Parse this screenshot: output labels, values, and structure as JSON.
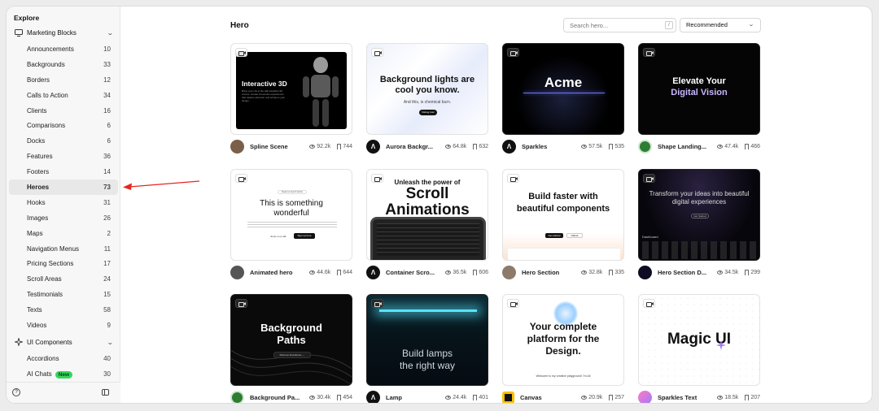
{
  "sidebar": {
    "heading": "Explore",
    "group1": {
      "label": "Marketing Blocks",
      "icon": "monitor-icon"
    },
    "items": [
      {
        "label": "Announcements",
        "count": "10"
      },
      {
        "label": "Backgrounds",
        "count": "33"
      },
      {
        "label": "Borders",
        "count": "12"
      },
      {
        "label": "Calls to Action",
        "count": "34"
      },
      {
        "label": "Clients",
        "count": "16"
      },
      {
        "label": "Comparisons",
        "count": "6"
      },
      {
        "label": "Docks",
        "count": "6"
      },
      {
        "label": "Features",
        "count": "36"
      },
      {
        "label": "Footers",
        "count": "14"
      },
      {
        "label": "Heroes",
        "count": "73"
      },
      {
        "label": "Hooks",
        "count": "31"
      },
      {
        "label": "Images",
        "count": "26"
      },
      {
        "label": "Maps",
        "count": "2"
      },
      {
        "label": "Navigation Menus",
        "count": "11"
      },
      {
        "label": "Pricing Sections",
        "count": "17"
      },
      {
        "label": "Scroll Areas",
        "count": "24"
      },
      {
        "label": "Testimonials",
        "count": "15"
      },
      {
        "label": "Texts",
        "count": "58"
      },
      {
        "label": "Videos",
        "count": "9"
      }
    ],
    "group2": {
      "label": "UI Components",
      "icon": "sparkle-icon"
    },
    "items2": [
      {
        "label": "Accordions",
        "count": "40"
      },
      {
        "label": "AI Chats",
        "count": "30",
        "badge": "New"
      }
    ],
    "help_glyph": "?"
  },
  "header": {
    "title": "Hero",
    "search_placeholder": "Search hero...",
    "search_shortcut": "/",
    "sort_value": "Recommended"
  },
  "cards": [
    {
      "name": "Spline Scene",
      "views": "92.2k",
      "saves": "744",
      "thumb": [
        "Interactive 3D",
        "Bring your UIs to life with beautiful 3D scenes. Create immersive experiences that capture attention and enhance your design."
      ]
    },
    {
      "name": "Aurora Backgr...",
      "views": "64.8k",
      "saves": "632",
      "thumb": [
        "Background lights are cool you know.",
        "And this, is chemical burn.",
        "Debug now"
      ]
    },
    {
      "name": "Sparkles",
      "views": "57.5k",
      "saves": "535",
      "thumb": [
        "Acme"
      ]
    },
    {
      "name": "Shape Landing...",
      "views": "47.4k",
      "saves": "466",
      "thumb": [
        "Elevate Your",
        "Digital Vision"
      ]
    },
    {
      "name": "Animated hero",
      "views": "44.6k",
      "saves": "644",
      "thumb": [
        "This is something",
        "wonderful",
        "Read our launch article",
        "Jump on a call",
        "Sign up here"
      ]
    },
    {
      "name": "Container Scro...",
      "views": "36.5k",
      "saves": "606",
      "thumb": [
        "Unleash the power of",
        "Scroll Animations"
      ]
    },
    {
      "name": "Hero Section",
      "views": "32.8k",
      "saves": "335",
      "thumb": [
        "Build faster with",
        "beautiful components",
        "Get started",
        "Github"
      ]
    },
    {
      "name": "Hero Section D...",
      "views": "34.5k",
      "saves": "299",
      "thumb": [
        "Transform your ideas into beautiful",
        "digital experiences",
        "Get Started",
        "Dashboard"
      ]
    },
    {
      "name": "Background Pa...",
      "views": "30.4k",
      "saves": "454",
      "thumb": [
        "Background",
        "Paths",
        "Discover Excellence →"
      ]
    },
    {
      "name": "Lamp",
      "views": "24.4k",
      "saves": "401",
      "thumb": [
        "Build lamps",
        "the right way"
      ]
    },
    {
      "name": "Canvas",
      "views": "20.9k",
      "saves": "257",
      "thumb": [
        "Your complete",
        "platform for the",
        "Design.",
        "Welcome to my creative playground! I'm Ali"
      ]
    },
    {
      "name": "Sparkles Text",
      "views": "18.5k",
      "saves": "207",
      "thumb": [
        "Magic UI"
      ]
    }
  ],
  "colors": {
    "arrow": "#e8251f",
    "badge_new": "#34d65c",
    "active_bg": "#e8e8e8"
  }
}
